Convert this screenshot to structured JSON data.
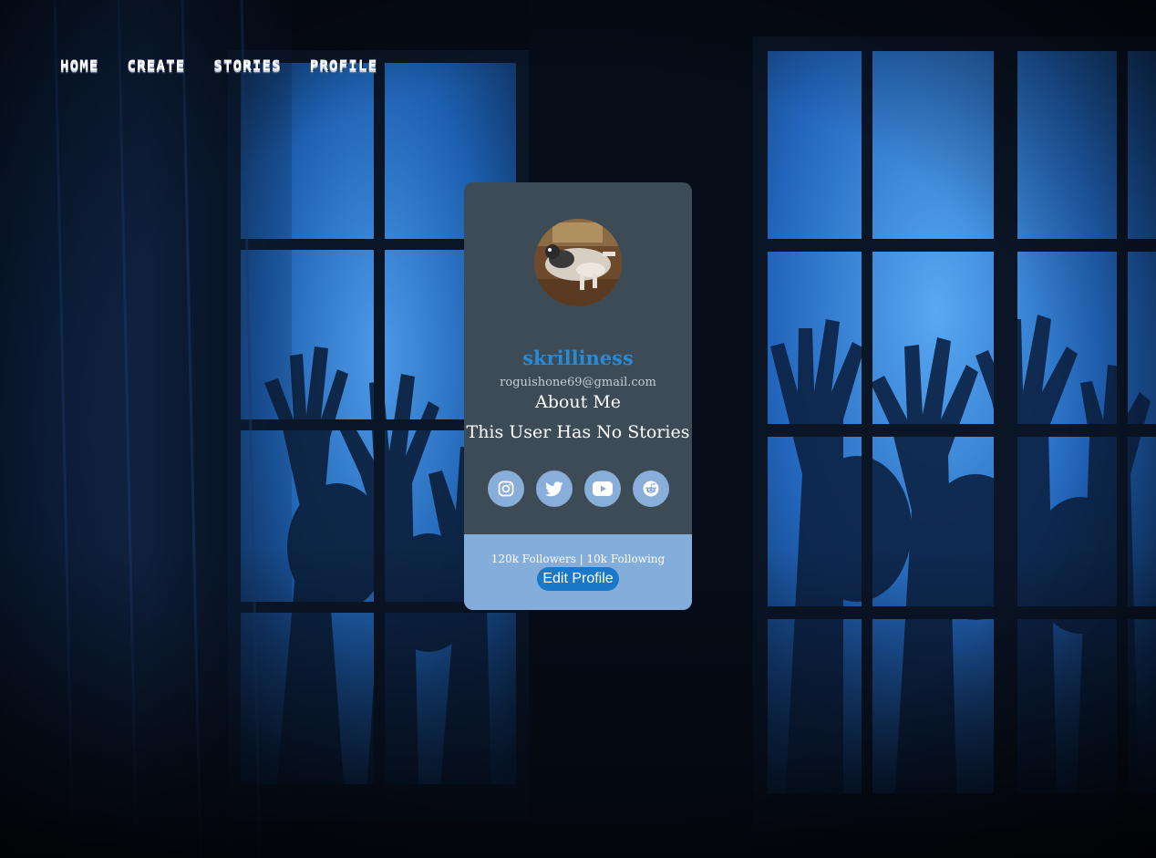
{
  "nav": {
    "items": [
      {
        "label": "HOME"
      },
      {
        "label": "CREATE"
      },
      {
        "label": "STORIES"
      },
      {
        "label": "PROFILE"
      }
    ]
  },
  "profile": {
    "username": "skrilliness",
    "email": "roguishone69@gmail.com",
    "about_heading": "About Me",
    "stories_text": "This User Has No Stories",
    "socials": [
      {
        "icon": "instagram-icon"
      },
      {
        "icon": "twitter-icon"
      },
      {
        "icon": "youtube-icon"
      },
      {
        "icon": "reddit-icon"
      }
    ],
    "counts": "120k Followers | 10k Following",
    "edit_label": "Edit Profile"
  },
  "colors": {
    "card_top": "#3c4b55",
    "card_bottom": "#83aedb",
    "username": "#2a8ad6",
    "social_bg": "#88aed9",
    "edit_button": "#1a78c9"
  }
}
